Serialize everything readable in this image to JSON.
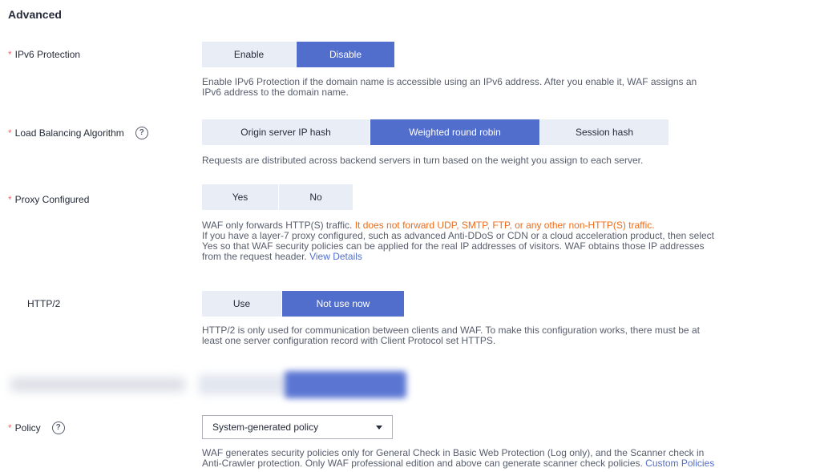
{
  "section": {
    "title": "Advanced"
  },
  "required_mark": "*",
  "help_glyph": "?",
  "ipv6": {
    "label": "IPv6 Protection",
    "options": [
      "Enable",
      "Disable"
    ],
    "selected": "Disable",
    "help": [
      "Enable IPv6 Protection if the domain name is accessible using an IPv6 address. After you enable it, WAF assigns an",
      "IPv6 address to the domain name."
    ]
  },
  "lb": {
    "label": "Load Balancing Algorithm",
    "options": [
      "Origin server IP hash",
      "Weighted round robin",
      "Session hash"
    ],
    "selected": "Weighted round robin",
    "help": "Requests are distributed across backend servers in turn based on the weight you assign to each server."
  },
  "proxy": {
    "label": "Proxy Configured",
    "options": [
      "Yes",
      "No"
    ],
    "selected": "",
    "help_line1_normal": "WAF only forwards HTTP(S) traffic. ",
    "help_line1_warning": "It does not forward UDP, SMTP, FTP, or any other non-HTTP(S) traffic.",
    "help_line2": "If you have a layer-7 proxy configured, such as advanced Anti-DDoS or CDN or a cloud acceleration product, then select",
    "help_line3": "Yes so that WAF security policies can be applied for the real IP addresses of visitors. WAF obtains those IP addresses",
    "help_line4": "from the request header. ",
    "view_details": "View Details"
  },
  "http2": {
    "label": "HTTP/2",
    "options": [
      "Use",
      "Not use now"
    ],
    "selected": "Not use now",
    "help": [
      "HTTP/2 is only used for communication between clients and WAF. To make this configuration works, there must be at",
      "least one server configuration record with Client Protocol set HTTPS."
    ]
  },
  "policy": {
    "label": "Policy",
    "selected": "System-generated policy",
    "help_line1": "WAF generates security policies only for General Check in Basic Web Protection (Log only), and the Scanner check in",
    "help_line2": "Anti-Crawler protection. Only WAF professional edition and above can generate scanner check policies. ",
    "custom_policies": "Custom Policies"
  },
  "colors": {
    "accent": "#526ecc",
    "segment_bg": "#e9edf6",
    "required": "#ef6a6a",
    "warning": "#ed6c1a",
    "help_text": "#575d6c"
  }
}
